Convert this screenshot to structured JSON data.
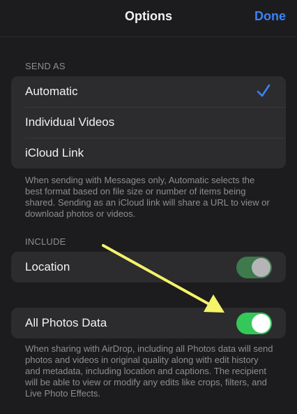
{
  "nav": {
    "title": "Options",
    "done_label": "Done"
  },
  "send_as": {
    "header": "SEND AS",
    "options": [
      {
        "label": "Automatic",
        "selected": true
      },
      {
        "label": "Individual Videos",
        "selected": false
      },
      {
        "label": "iCloud Link",
        "selected": false
      }
    ],
    "footnote": "When sending with Messages only, Automatic selects the best format based on file size or number of items being shared. Sending as an iCloud link will share a URL to view or download photos or videos."
  },
  "include": {
    "header": "INCLUDE",
    "location": {
      "label": "Location",
      "on": true,
      "enabled": false
    },
    "all_photos_data": {
      "label": "All Photos Data",
      "on": true
    },
    "footnote": "When sharing with AirDrop, including all Photos data will send photos and videos in original quality along with edit history and metadata, including location and captions. The recipient will be able to view or modify any edits like crops, filters, and Live Photo Effects."
  },
  "colors": {
    "accent": "#3a82f7",
    "toggle_on": "#34c759",
    "annotation_arrow": "#f4f36a"
  }
}
